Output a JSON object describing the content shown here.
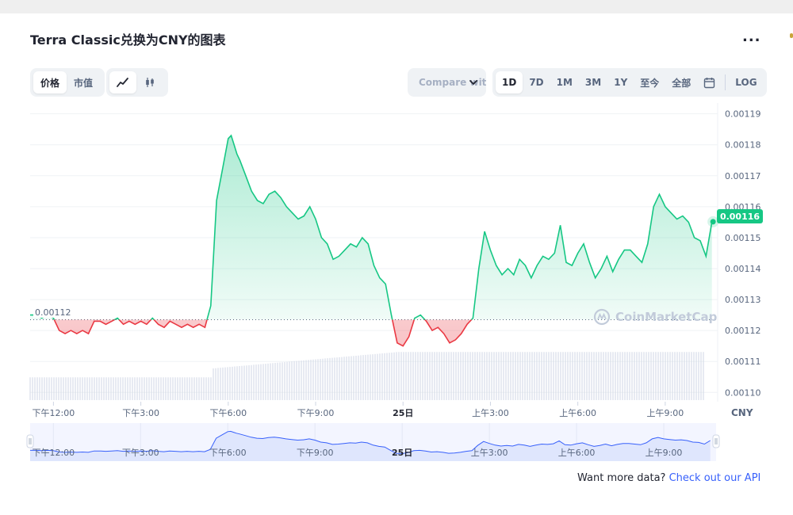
{
  "header": {
    "title": "Terra Classic兑换为CNY的图表",
    "more_label": "..."
  },
  "toolbar": {
    "type_tabs": [
      {
        "label": "价格",
        "active": true
      },
      {
        "label": "市值",
        "active": false
      }
    ],
    "chart_icons": [
      "line-chart-icon",
      "candlestick-icon"
    ],
    "compare_label": "Compare with",
    "range_tabs": [
      {
        "label": "1D",
        "active": true
      },
      {
        "label": "7D",
        "active": false
      },
      {
        "label": "1M",
        "active": false
      },
      {
        "label": "3M",
        "active": false
      },
      {
        "label": "1Y",
        "active": false
      },
      {
        "label": "至今",
        "active": false
      },
      {
        "label": "全部",
        "active": false
      }
    ],
    "calendar_icon": "calendar-icon",
    "log_label": "LOG"
  },
  "chart_data": {
    "type": "area",
    "title": "",
    "xlabel": "",
    "ylabel": "CNY",
    "ylim": [
      0.001097,
      0.0011935
    ],
    "y_ticks": [
      "0.00119",
      "0.00118",
      "0.00117",
      "0.00116",
      "0.00115",
      "0.00114",
      "0.00113",
      "0.00112",
      "0.00111",
      "0.00110"
    ],
    "y_tick_values": [
      0.00119,
      0.00118,
      0.00117,
      0.00116,
      0.00115,
      0.00114,
      0.00113,
      0.00112,
      0.00111,
      0.0011
    ],
    "x_range_hours": [
      -0.8,
      22.8
    ],
    "x_ticks": [
      {
        "t": 0,
        "label": "下午12:00",
        "bold": false
      },
      {
        "t": 3,
        "label": "下午3:00",
        "bold": false
      },
      {
        "t": 6,
        "label": "下午6:00",
        "bold": false
      },
      {
        "t": 9,
        "label": "下午9:00",
        "bold": false
      },
      {
        "t": 12,
        "label": "25日",
        "bold": true
      },
      {
        "t": 15,
        "label": "上午3:00",
        "bold": false
      },
      {
        "t": 18,
        "label": "上午6:00",
        "bold": false
      },
      {
        "t": 21,
        "label": "上午9:00",
        "bold": false
      }
    ],
    "baseline": 0.0011235,
    "baseline_label": "0.00112",
    "current_price_label": "0.00116",
    "up_color": "#16c784",
    "down_color": "#ea3943",
    "series": [
      {
        "x": [
          -0.8,
          -0.6,
          -0.4,
          -0.2,
          0,
          0.2,
          0.4,
          0.6,
          0.8,
          1,
          1.2,
          1.4,
          1.6,
          1.8,
          2,
          2.2,
          2.4,
          2.6,
          2.8,
          3,
          3.2,
          3.4,
          3.6,
          3.8,
          4,
          4.2,
          4.4,
          4.6,
          4.8,
          5,
          5.2,
          5.4,
          5.6,
          5.8,
          6,
          6.1,
          6.2,
          6.3,
          6.4,
          6.6,
          6.8,
          7,
          7.2,
          7.4,
          7.6,
          7.8,
          8,
          8.2,
          8.4,
          8.6,
          8.8,
          9,
          9.2,
          9.4,
          9.6,
          9.8,
          10,
          10.2,
          10.4,
          10.6,
          10.8,
          11,
          11.2,
          11.4,
          11.6,
          11.8,
          12,
          12.2,
          12.4,
          12.6,
          12.8,
          13,
          13.2,
          13.4,
          13.6,
          13.8,
          14,
          14.2,
          14.4,
          14.6,
          14.8,
          15,
          15.2,
          15.4,
          15.6,
          15.8,
          16,
          16.2,
          16.4,
          16.6,
          16.8,
          17,
          17.2,
          17.4,
          17.6,
          17.8,
          18,
          18.2,
          18.4,
          18.6,
          18.8,
          19,
          19.2,
          19.4,
          19.6,
          19.8,
          20,
          20.2,
          20.4,
          20.6,
          20.8,
          21,
          21.2,
          21.4,
          21.6,
          21.8,
          22,
          22.2,
          22.4,
          22.6
        ],
        "y": [
          0.001125,
          0.001125,
          0.001124,
          0.001125,
          0.001124,
          0.00112,
          0.001119,
          0.00112,
          0.001119,
          0.00112,
          0.001119,
          0.001123,
          0.001123,
          0.001122,
          0.001123,
          0.001124,
          0.001122,
          0.001123,
          0.001122,
          0.001123,
          0.001122,
          0.001124,
          0.001122,
          0.001121,
          0.001123,
          0.001122,
          0.001121,
          0.001122,
          0.001121,
          0.001122,
          0.001121,
          0.001128,
          0.001162,
          0.001172,
          0.001182,
          0.001183,
          0.00118,
          0.001177,
          0.001175,
          0.00117,
          0.001165,
          0.001162,
          0.001161,
          0.001164,
          0.001165,
          0.001163,
          0.00116,
          0.001158,
          0.001156,
          0.001157,
          0.00116,
          0.001156,
          0.00115,
          0.001148,
          0.001143,
          0.001144,
          0.001146,
          0.001148,
          0.001147,
          0.00115,
          0.001148,
          0.001141,
          0.001137,
          0.001135,
          0.001125,
          0.001116,
          0.001115,
          0.001118,
          0.001124,
          0.001125,
          0.001123,
          0.00112,
          0.001121,
          0.001119,
          0.001116,
          0.001117,
          0.001119,
          0.001122,
          0.001124,
          0.00114,
          0.001152,
          0.001146,
          0.001141,
          0.001138,
          0.00114,
          0.001138,
          0.001143,
          0.001141,
          0.001137,
          0.001141,
          0.001144,
          0.001143,
          0.001145,
          0.001154,
          0.001142,
          0.001141,
          0.001145,
          0.001148,
          0.001142,
          0.001137,
          0.00114,
          0.001144,
          0.001139,
          0.001143,
          0.001146,
          0.001146,
          0.001144,
          0.001142,
          0.001148,
          0.00116,
          0.001164,
          0.00116,
          0.001158,
          0.001156,
          0.001157,
          0.001155,
          0.00115,
          0.001149,
          0.001144,
          0.001155
        ]
      }
    ],
    "volume": {
      "x_range_hours": [
        -0.8,
        22.8
      ],
      "start_value": 0.18,
      "end_value": 0.38,
      "step_hour": 5.6
    },
    "navigator": {
      "x_ticks": [
        {
          "t": 0,
          "label": "下午12:00",
          "bold": false
        },
        {
          "t": 3,
          "label": "下午3:00",
          "bold": false
        },
        {
          "t": 6,
          "label": "下午6:00",
          "bold": false
        },
        {
          "t": 9,
          "label": "下午9:00",
          "bold": false
        },
        {
          "t": 12,
          "label": "25日",
          "bold": true
        },
        {
          "t": 15,
          "label": "上午3:00",
          "bold": false
        },
        {
          "t": 18,
          "label": "上午6:00",
          "bold": false
        },
        {
          "t": 21,
          "label": "上午9:00",
          "bold": false
        }
      ],
      "fill_color": "#dfe6fd",
      "line_color": "#3861fb"
    }
  },
  "footer": {
    "prefix": "Want more data?",
    "link": "Check out our API"
  },
  "watermark": {
    "text": "CoinMarketCap",
    "icon": "coinmarketcap-logo-icon"
  }
}
